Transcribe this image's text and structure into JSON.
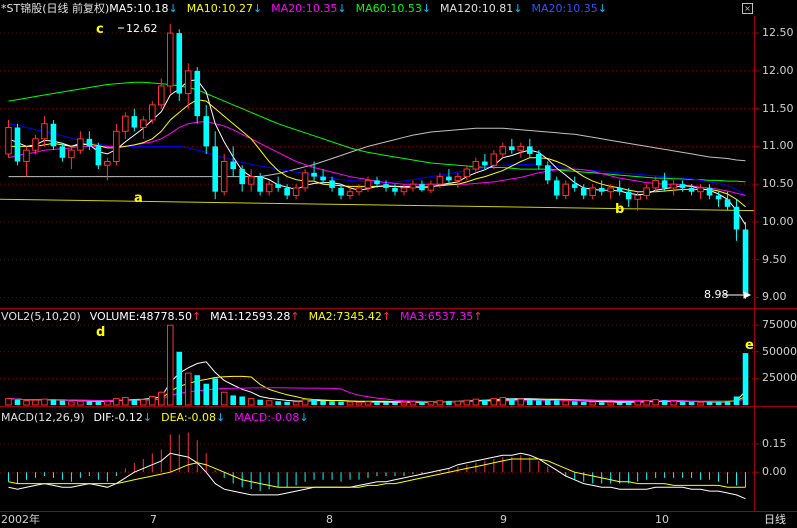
{
  "main_header": {
    "title": "*ST锦股",
    "mode": "(日线 前复权)",
    "ma5": "MA5:10.18",
    "ma10": "MA10:10.27",
    "ma20": "MA20:10.35",
    "ma60": "MA60:10.53",
    "ma120": "MA120:10.81",
    "ma20b": "MA20:10.35",
    "arrow": "↓"
  },
  "vol_header": {
    "title": "VOL2(5,10,20)",
    "volume": "VOLUME:48778.50",
    "ma1": "MA1:12593.28",
    "ma2": "MA2:7345.42",
    "ma3": "MA3:6537.35",
    "arrow_up": "↑"
  },
  "macd_header": {
    "title": "MACD(12,26,9)",
    "dif": "DIF:-0.12",
    "dea": "DEA:-0.08",
    "macd": "MACD:-0.08",
    "arrow": "↓"
  },
  "annotations": {
    "a": "a",
    "b": "b",
    "c": "c",
    "d": "d",
    "e": "e",
    "high": "12.62",
    "low": "8.98"
  },
  "x_axis": {
    "year": "2002年",
    "m7": "7",
    "m8": "8",
    "m9": "9",
    "m10": "10",
    "period": "日线"
  },
  "price_axis": [
    "12.50",
    "12.00",
    "11.50",
    "11.00",
    "10.50",
    "10.00",
    "9.50",
    "9.00"
  ],
  "vol_axis": [
    "75000",
    "50000",
    "25000"
  ],
  "macd_axis": [
    "0.15",
    "0.00"
  ],
  "close_icon": "×",
  "colors": {
    "up": "#ff3030",
    "down": "#00ffff",
    "ma5": "#ffffff",
    "ma10": "#ffff00",
    "ma20": "#ff00ff",
    "ma60": "#00ff00",
    "ma120": "#c0c0c0",
    "ma20b": "#0000ff",
    "trendline": "#d0d000",
    "grid": "#800000"
  },
  "chart_data": {
    "type": "candlestick",
    "price_range": [
      8.9,
      12.7
    ],
    "volume_range": [
      0,
      78000
    ],
    "macd_range": [
      -0.2,
      0.25
    ],
    "candles": [
      [
        10.9,
        11.35,
        10.85,
        11.25,
        6000
      ],
      [
        11.25,
        11.3,
        10.75,
        10.8,
        5000
      ],
      [
        10.8,
        11.0,
        10.6,
        10.95,
        4000
      ],
      [
        10.95,
        11.15,
        10.9,
        11.1,
        4500
      ],
      [
        11.1,
        11.4,
        11.0,
        11.3,
        5500
      ],
      [
        11.3,
        11.35,
        10.95,
        11.0,
        5000
      ],
      [
        11.0,
        11.05,
        10.8,
        10.85,
        4000
      ],
      [
        10.85,
        11.0,
        10.7,
        10.95,
        3000
      ],
      [
        10.95,
        11.2,
        10.9,
        11.1,
        3500
      ],
      [
        11.1,
        11.2,
        10.95,
        11.0,
        3000
      ],
      [
        11.0,
        11.05,
        10.7,
        10.75,
        4000
      ],
      [
        10.75,
        10.85,
        10.55,
        10.8,
        3500
      ],
      [
        10.8,
        11.3,
        10.75,
        11.2,
        6000
      ],
      [
        11.2,
        11.45,
        11.1,
        11.4,
        7000
      ],
      [
        11.4,
        11.5,
        11.2,
        11.25,
        5500
      ],
      [
        11.25,
        11.4,
        11.1,
        11.35,
        5000
      ],
      [
        11.35,
        11.6,
        11.3,
        11.55,
        8000
      ],
      [
        11.55,
        11.9,
        11.5,
        11.8,
        12000
      ],
      [
        11.8,
        12.62,
        11.7,
        12.5,
        75000
      ],
      [
        12.5,
        12.55,
        11.6,
        11.7,
        50000
      ],
      [
        11.7,
        12.1,
        11.5,
        12.0,
        30000
      ],
      [
        12.0,
        12.05,
        11.3,
        11.4,
        28000
      ],
      [
        11.4,
        11.55,
        10.9,
        11.0,
        20000
      ],
      [
        11.0,
        11.2,
        10.3,
        10.4,
        25000
      ],
      [
        10.4,
        10.9,
        10.35,
        10.8,
        12000
      ],
      [
        10.8,
        11.0,
        10.6,
        10.7,
        9000
      ],
      [
        10.7,
        10.75,
        10.4,
        10.5,
        8000
      ],
      [
        10.5,
        10.7,
        10.4,
        10.6,
        6000
      ],
      [
        10.6,
        10.65,
        10.35,
        10.4,
        5000
      ],
      [
        10.4,
        10.55,
        10.35,
        10.5,
        4000
      ],
      [
        10.5,
        10.6,
        10.4,
        10.45,
        3500
      ],
      [
        10.45,
        10.5,
        10.3,
        10.35,
        3000
      ],
      [
        10.35,
        10.5,
        10.3,
        10.45,
        3000
      ],
      [
        10.45,
        10.7,
        10.4,
        10.65,
        5000
      ],
      [
        10.65,
        10.8,
        10.55,
        10.6,
        5500
      ],
      [
        10.6,
        10.7,
        10.5,
        10.55,
        4000
      ],
      [
        10.55,
        10.6,
        10.4,
        10.45,
        3500
      ],
      [
        10.45,
        10.5,
        10.3,
        10.35,
        3000
      ],
      [
        10.35,
        10.45,
        10.3,
        10.4,
        2800
      ],
      [
        10.4,
        10.5,
        10.35,
        10.45,
        2500
      ],
      [
        10.45,
        10.6,
        10.4,
        10.55,
        3000
      ],
      [
        10.55,
        10.6,
        10.45,
        10.5,
        2800
      ],
      [
        10.5,
        10.55,
        10.4,
        10.45,
        2500
      ],
      [
        10.45,
        10.5,
        10.35,
        10.4,
        2400
      ],
      [
        10.4,
        10.5,
        10.35,
        10.45,
        2600
      ],
      [
        10.45,
        10.55,
        10.4,
        10.5,
        3000
      ],
      [
        10.5,
        10.55,
        10.4,
        10.42,
        2800
      ],
      [
        10.42,
        10.55,
        10.38,
        10.5,
        3200
      ],
      [
        10.5,
        10.65,
        10.45,
        10.6,
        4000
      ],
      [
        10.6,
        10.7,
        10.5,
        10.55,
        3800
      ],
      [
        10.55,
        10.65,
        10.45,
        10.6,
        3500
      ],
      [
        10.6,
        10.75,
        10.55,
        10.7,
        4500
      ],
      [
        10.7,
        10.85,
        10.65,
        10.8,
        5500
      ],
      [
        10.8,
        10.9,
        10.7,
        10.75,
        5000
      ],
      [
        10.75,
        10.95,
        10.7,
        10.9,
        6000
      ],
      [
        10.9,
        11.05,
        10.85,
        11.0,
        7000
      ],
      [
        11.0,
        11.1,
        10.9,
        10.95,
        6000
      ],
      [
        10.95,
        11.05,
        10.85,
        11.0,
        5500
      ],
      [
        11.0,
        11.1,
        10.85,
        10.9,
        5000
      ],
      [
        10.9,
        10.95,
        10.7,
        10.75,
        4500
      ],
      [
        10.75,
        10.8,
        10.5,
        10.55,
        5000
      ],
      [
        10.55,
        10.6,
        10.3,
        10.35,
        4500
      ],
      [
        10.35,
        10.55,
        10.3,
        10.5,
        4000
      ],
      [
        10.5,
        10.6,
        10.4,
        10.45,
        3500
      ],
      [
        10.45,
        10.5,
        10.3,
        10.35,
        3000
      ],
      [
        10.35,
        10.5,
        10.3,
        10.45,
        2800
      ],
      [
        10.45,
        10.55,
        10.35,
        10.4,
        2600
      ],
      [
        10.4,
        10.5,
        10.3,
        10.45,
        2500
      ],
      [
        10.45,
        10.55,
        10.35,
        10.4,
        2400
      ],
      [
        10.4,
        10.45,
        10.2,
        10.3,
        3000
      ],
      [
        10.3,
        10.4,
        10.15,
        10.35,
        3500
      ],
      [
        10.35,
        10.5,
        10.3,
        10.45,
        4000
      ],
      [
        10.45,
        10.6,
        10.4,
        10.55,
        5000
      ],
      [
        10.55,
        10.65,
        10.4,
        10.45,
        4500
      ],
      [
        10.45,
        10.55,
        10.35,
        10.5,
        3500
      ],
      [
        10.5,
        10.55,
        10.4,
        10.45,
        3000
      ],
      [
        10.45,
        10.5,
        10.35,
        10.4,
        2800
      ],
      [
        10.4,
        10.5,
        10.3,
        10.45,
        2500
      ],
      [
        10.45,
        10.5,
        10.3,
        10.35,
        2600
      ],
      [
        10.35,
        10.4,
        10.2,
        10.3,
        3000
      ],
      [
        10.3,
        10.4,
        10.15,
        10.2,
        3500
      ],
      [
        10.2,
        10.3,
        9.75,
        9.9,
        8000
      ],
      [
        9.9,
        10.0,
        8.98,
        9.05,
        48778
      ]
    ],
    "ma5": [
      11.1,
      11.05,
      11.0,
      11.02,
      11.08,
      11.07,
      11.04,
      11.0,
      11.04,
      11.02,
      10.93,
      10.9,
      10.96,
      11.06,
      11.15,
      11.24,
      11.35,
      11.46,
      11.68,
      11.76,
      11.87,
      11.88,
      11.72,
      11.3,
      11.06,
      10.86,
      10.68,
      10.6,
      10.6,
      10.56,
      10.49,
      10.46,
      10.43,
      10.48,
      10.51,
      10.52,
      10.52,
      10.5,
      10.45,
      10.42,
      10.44,
      10.47,
      10.48,
      10.47,
      10.47,
      10.47,
      10.46,
      10.46,
      10.49,
      10.51,
      10.53,
      10.6,
      10.65,
      10.69,
      10.75,
      10.85,
      10.88,
      10.92,
      10.95,
      10.92,
      10.83,
      10.71,
      10.62,
      10.52,
      10.45,
      10.43,
      10.42,
      10.42,
      10.41,
      10.38,
      10.36,
      10.37,
      10.42,
      10.44,
      10.46,
      10.48,
      10.47,
      10.44,
      10.42,
      10.37,
      10.3,
      10.15,
      9.96
    ],
    "ma10": [
      11.0,
      11.0,
      11.0,
      11.0,
      11.02,
      11.04,
      11.02,
      11.0,
      11.02,
      11.03,
      11.01,
      10.98,
      10.98,
      11.0,
      11.02,
      11.05,
      11.1,
      11.2,
      11.35,
      11.45,
      11.55,
      11.62,
      11.6,
      11.5,
      11.4,
      11.3,
      11.2,
      11.1,
      10.95,
      10.8,
      10.68,
      10.6,
      10.56,
      10.54,
      10.54,
      10.5,
      10.49,
      10.48,
      10.47,
      10.47,
      10.47,
      10.47,
      10.47,
      10.47,
      10.46,
      10.46,
      10.46,
      10.47,
      10.48,
      10.49,
      10.5,
      10.53,
      10.57,
      10.6,
      10.64,
      10.68,
      10.74,
      10.8,
      10.85,
      10.85,
      10.84,
      10.8,
      10.75,
      10.68,
      10.6,
      10.54,
      10.5,
      10.47,
      10.45,
      10.42,
      10.4,
      10.4,
      10.4,
      10.41,
      10.42,
      10.43,
      10.43,
      10.43,
      10.43,
      10.41,
      10.37,
      10.3,
      10.2
    ],
    "ma20": [
      10.85,
      10.88,
      10.9,
      10.92,
      10.95,
      10.96,
      10.97,
      10.98,
      11.0,
      11.0,
      11.0,
      11.0,
      11.0,
      11.0,
      11.02,
      11.04,
      11.06,
      11.1,
      11.17,
      11.25,
      11.3,
      11.32,
      11.33,
      11.3,
      11.27,
      11.22,
      11.16,
      11.1,
      11.04,
      10.98,
      10.92,
      10.86,
      10.8,
      10.76,
      10.72,
      10.69,
      10.66,
      10.63,
      10.6,
      10.58,
      10.56,
      10.54,
      10.52,
      10.51,
      10.5,
      10.5,
      10.5,
      10.5,
      10.5,
      10.5,
      10.5,
      10.5,
      10.51,
      10.52,
      10.53,
      10.55,
      10.57,
      10.59,
      10.62,
      10.65,
      10.67,
      10.69,
      10.7,
      10.7,
      10.69,
      10.67,
      10.64,
      10.61,
      10.58,
      10.56,
      10.54,
      10.52,
      10.51,
      10.5,
      10.5,
      10.49,
      10.48,
      10.46,
      10.45,
      10.43,
      10.41,
      10.38,
      10.35
    ],
    "ma60": [
      11.6,
      11.62,
      11.64,
      11.66,
      11.68,
      11.7,
      11.72,
      11.74,
      11.76,
      11.78,
      11.8,
      11.82,
      11.83,
      11.84,
      11.85,
      11.85,
      11.84,
      11.83,
      11.82,
      11.8,
      11.78,
      11.75,
      11.7,
      11.65,
      11.6,
      11.55,
      11.5,
      11.45,
      11.4,
      11.35,
      11.3,
      11.26,
      11.22,
      11.18,
      11.14,
      11.1,
      11.06,
      11.02,
      10.98,
      10.95,
      10.92,
      10.9,
      10.88,
      10.86,
      10.84,
      10.82,
      10.8,
      10.78,
      10.77,
      10.76,
      10.75,
      10.74,
      10.73,
      10.72,
      10.72,
      10.72,
      10.71,
      10.7,
      10.7,
      10.7,
      10.7,
      10.69,
      10.68,
      10.67,
      10.66,
      10.65,
      10.64,
      10.63,
      10.62,
      10.61,
      10.6,
      10.59,
      10.58,
      10.58,
      10.57,
      10.57,
      10.56,
      10.56,
      10.55,
      10.55,
      10.54,
      10.54,
      10.53
    ],
    "ma120": [
      10.6,
      10.6,
      10.6,
      10.6,
      10.6,
      10.6,
      10.6,
      10.6,
      10.6,
      10.6,
      10.6,
      10.6,
      10.6,
      10.6,
      10.6,
      10.6,
      10.6,
      10.6,
      10.6,
      10.6,
      10.6,
      10.6,
      10.6,
      10.6,
      10.6,
      10.6,
      10.6,
      10.6,
      10.6,
      10.62,
      10.64,
      10.67,
      10.7,
      10.73,
      10.76,
      10.8,
      10.84,
      10.88,
      10.92,
      10.96,
      11.0,
      11.03,
      11.06,
      11.09,
      11.12,
      11.15,
      11.17,
      11.19,
      11.2,
      11.21,
      11.22,
      11.23,
      11.24,
      11.24,
      11.24,
      11.24,
      11.23,
      11.22,
      11.21,
      11.2,
      11.19,
      11.18,
      11.17,
      11.16,
      11.14,
      11.12,
      11.1,
      11.08,
      11.06,
      11.04,
      11.02,
      11.0,
      10.98,
      10.96,
      10.94,
      10.92,
      10.9,
      10.88,
      10.86,
      10.85,
      10.84,
      10.82,
      10.81
    ],
    "ma20b": [
      11.3,
      11.28,
      11.25,
      11.22,
      11.2,
      11.17,
      11.14,
      11.11,
      11.08,
      11.05,
      11.03,
      11.01,
      11.0,
      11.0,
      11.0,
      11.0,
      11.0,
      11.0,
      11.0,
      11.0,
      10.98,
      10.95,
      10.92,
      10.88,
      10.85,
      10.82,
      10.79,
      10.76,
      10.74,
      10.72,
      10.7,
      10.68,
      10.66,
      10.64,
      10.62,
      10.6,
      10.58,
      10.56,
      10.55,
      10.54,
      10.53,
      10.52,
      10.52,
      10.53,
      10.54,
      10.56,
      10.58,
      10.6,
      10.62,
      10.64,
      10.66,
      10.68,
      10.7,
      10.72,
      10.74,
      10.75,
      10.76,
      10.76,
      10.76,
      10.75,
      10.74,
      10.73,
      10.72,
      10.7,
      10.69,
      10.68,
      10.67,
      10.66,
      10.65,
      10.64,
      10.63,
      10.62,
      10.61,
      10.6,
      10.59,
      10.58,
      10.57,
      10.55,
      10.53,
      10.51,
      10.48,
      10.43,
      10.35
    ],
    "trendline": [
      [
        0,
        10.3
      ],
      [
        82,
        10.15
      ]
    ],
    "macd_bars": [
      -0.05,
      -0.06,
      -0.04,
      -0.03,
      -0.02,
      -0.03,
      -0.04,
      -0.05,
      -0.03,
      -0.02,
      -0.04,
      -0.05,
      -0.02,
      0.02,
      0.05,
      0.07,
      0.1,
      0.12,
      0.2,
      0.2,
      0.21,
      0.17,
      0.1,
      0.01,
      -0.03,
      -0.06,
      -0.08,
      -0.09,
      -0.1,
      -0.09,
      -0.08,
      -0.08,
      -0.07,
      -0.05,
      -0.04,
      -0.04,
      -0.04,
      -0.05,
      -0.04,
      -0.04,
      -0.03,
      -0.02,
      -0.02,
      -0.02,
      -0.02,
      -0.01,
      -0.01,
      0.0,
      0.01,
      0.02,
      0.03,
      0.04,
      0.05,
      0.06,
      0.07,
      0.08,
      0.08,
      0.09,
      0.08,
      0.06,
      0.03,
      0.0,
      -0.02,
      -0.04,
      -0.05,
      -0.06,
      -0.06,
      -0.06,
      -0.06,
      -0.06,
      -0.05,
      -0.04,
      -0.03,
      -0.03,
      -0.03,
      -0.03,
      -0.03,
      -0.04,
      -0.04,
      -0.05,
      -0.06,
      -0.07,
      -0.08
    ],
    "dif": [
      -0.08,
      -0.09,
      -0.08,
      -0.07,
      -0.06,
      -0.07,
      -0.08,
      -0.08,
      -0.07,
      -0.06,
      -0.07,
      -0.08,
      -0.06,
      -0.03,
      0.0,
      0.02,
      0.04,
      0.06,
      0.1,
      0.09,
      0.08,
      0.05,
      0.0,
      -0.06,
      -0.09,
      -0.1,
      -0.11,
      -0.12,
      -0.12,
      -0.12,
      -0.12,
      -0.11,
      -0.1,
      -0.09,
      -0.08,
      -0.08,
      -0.08,
      -0.08,
      -0.08,
      -0.07,
      -0.06,
      -0.05,
      -0.05,
      -0.04,
      -0.03,
      -0.02,
      -0.01,
      0.0,
      0.01,
      0.02,
      0.04,
      0.05,
      0.06,
      0.07,
      0.08,
      0.09,
      0.09,
      0.1,
      0.09,
      0.07,
      0.04,
      0.01,
      -0.02,
      -0.04,
      -0.06,
      -0.07,
      -0.08,
      -0.08,
      -0.09,
      -0.09,
      -0.09,
      -0.09,
      -0.08,
      -0.08,
      -0.08,
      -0.08,
      -0.09,
      -0.09,
      -0.1,
      -0.1,
      -0.11,
      -0.12,
      -0.14
    ],
    "dea": [
      -0.05,
      -0.06,
      -0.06,
      -0.06,
      -0.06,
      -0.06,
      -0.06,
      -0.06,
      -0.06,
      -0.06,
      -0.06,
      -0.06,
      -0.06,
      -0.05,
      -0.04,
      -0.03,
      -0.02,
      -0.01,
      0.0,
      0.02,
      0.04,
      0.05,
      0.04,
      0.02,
      0.0,
      -0.02,
      -0.04,
      -0.05,
      -0.06,
      -0.07,
      -0.08,
      -0.08,
      -0.08,
      -0.08,
      -0.08,
      -0.08,
      -0.08,
      -0.08,
      -0.08,
      -0.08,
      -0.07,
      -0.07,
      -0.06,
      -0.06,
      -0.05,
      -0.04,
      -0.03,
      -0.02,
      -0.01,
      0.0,
      0.01,
      0.02,
      0.03,
      0.04,
      0.05,
      0.06,
      0.07,
      0.07,
      0.07,
      0.07,
      0.06,
      0.04,
      0.02,
      0.0,
      -0.01,
      -0.02,
      -0.03,
      -0.04,
      -0.05,
      -0.05,
      -0.06,
      -0.06,
      -0.06,
      -0.06,
      -0.07,
      -0.07,
      -0.07,
      -0.07,
      -0.07,
      -0.07,
      -0.08,
      -0.08,
      -0.08
    ]
  }
}
